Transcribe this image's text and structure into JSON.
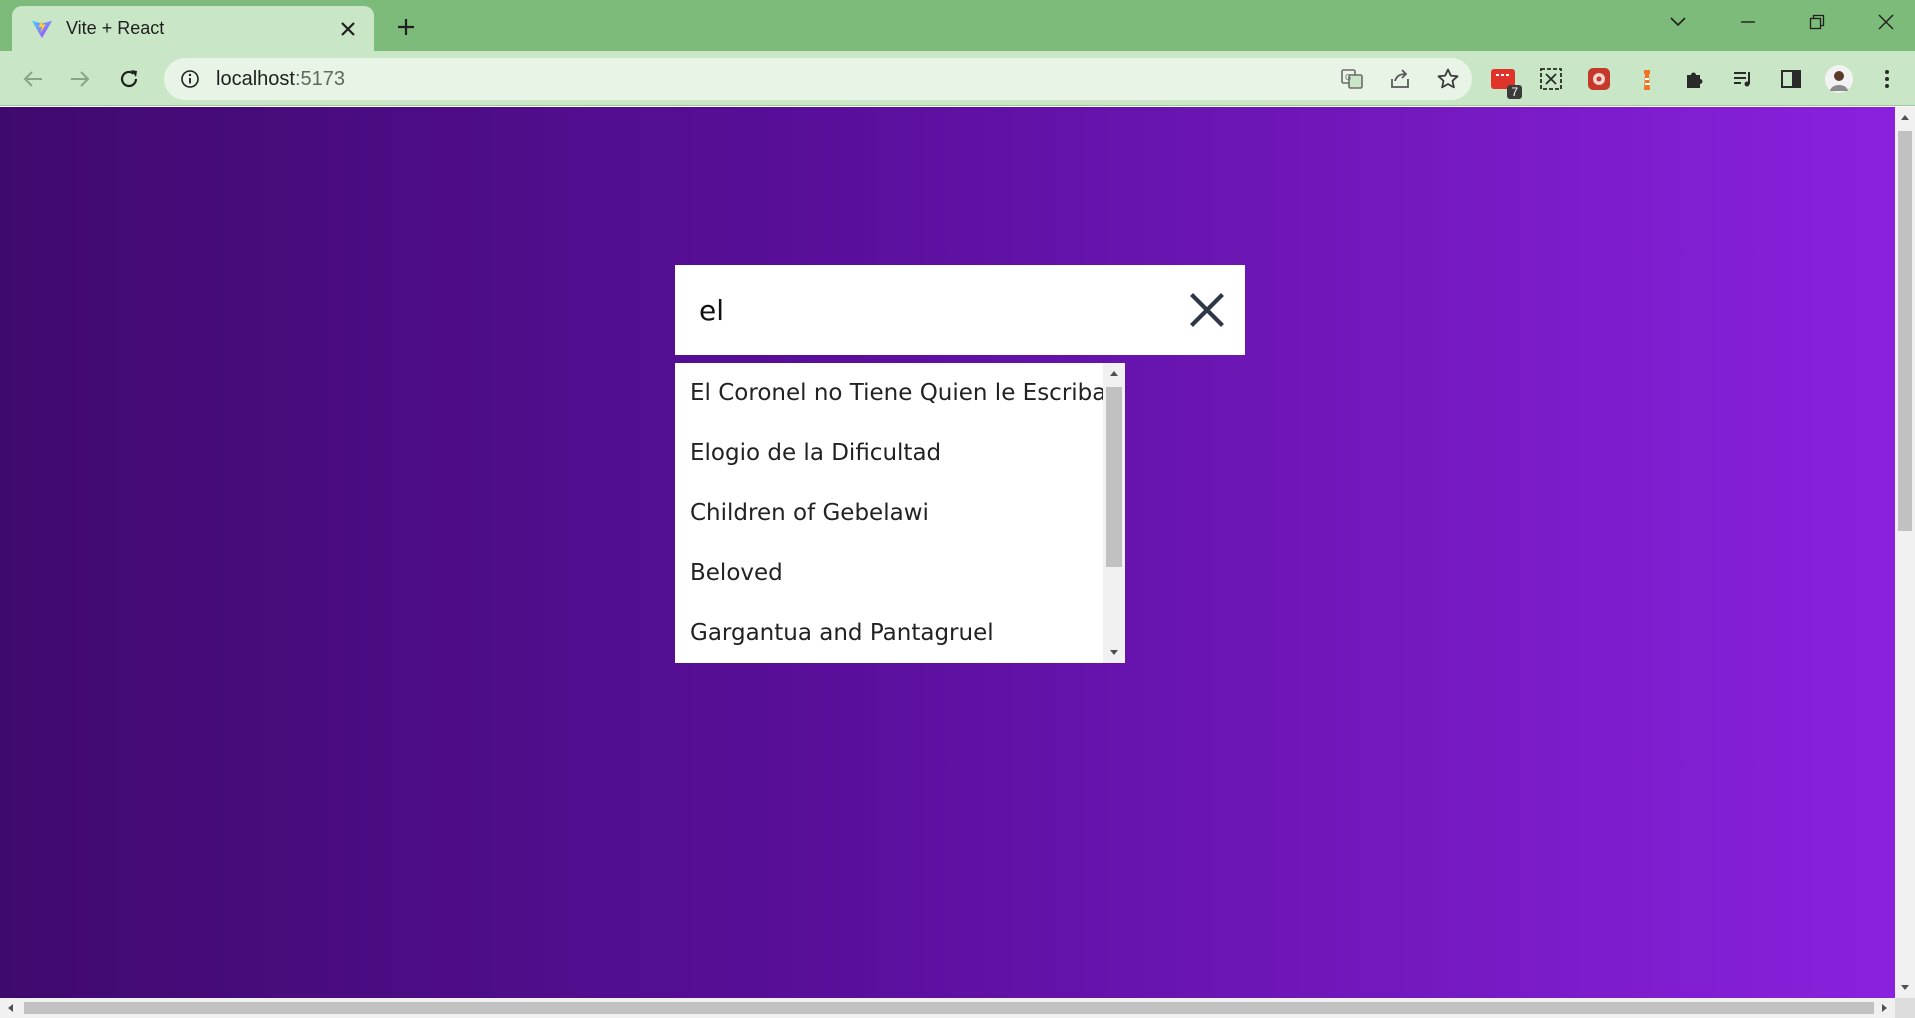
{
  "browser": {
    "tab": {
      "title": "Vite + React",
      "favicon": "vite-logo-icon"
    },
    "omnibox": {
      "host": "localhost",
      "port": ":5173"
    },
    "extension_badge": "7"
  },
  "colors": {
    "gradient_start": "#3f0a6e",
    "gradient_end": "#8a21de",
    "chrome_green": "#7dbb7a",
    "toolbar_green": "#c9e7c6"
  },
  "search": {
    "value": "el",
    "clear_icon": "close-icon"
  },
  "results": [
    {
      "title": "El Coronel no Tiene Quien le Escriba"
    },
    {
      "title": "Elogio de la Dificultad"
    },
    {
      "title": "Children of Gebelawi"
    },
    {
      "title": "Beloved"
    },
    {
      "title": "Gargantua and Pantagruel"
    }
  ]
}
